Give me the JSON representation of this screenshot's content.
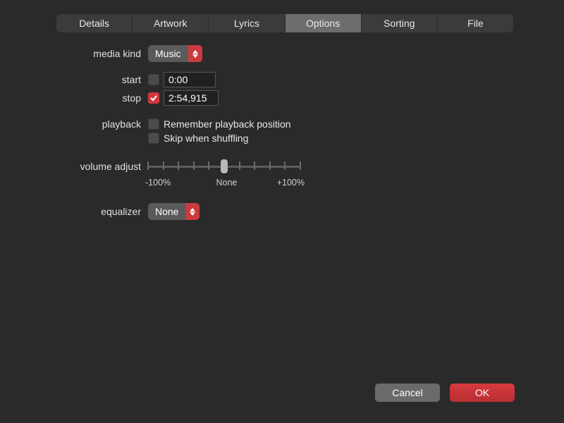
{
  "tabs": [
    {
      "label": "Details",
      "active": false
    },
    {
      "label": "Artwork",
      "active": false
    },
    {
      "label": "Lyrics",
      "active": false
    },
    {
      "label": "Options",
      "active": true
    },
    {
      "label": "Sorting",
      "active": false
    },
    {
      "label": "File",
      "active": false
    }
  ],
  "labels": {
    "media_kind": "media kind",
    "start": "start",
    "stop": "stop",
    "playback": "playback",
    "volume_adjust": "volume adjust",
    "equalizer": "equalizer"
  },
  "media_kind": {
    "value": "Music"
  },
  "start": {
    "checked": false,
    "value": "0:00"
  },
  "stop": {
    "checked": true,
    "value": "2:54,915"
  },
  "playback": {
    "remember": {
      "checked": false,
      "label": "Remember playback position"
    },
    "skip": {
      "checked": false,
      "label": "Skip when shuffling"
    }
  },
  "volume_adjust": {
    "ticks": 11,
    "position": 0.5,
    "captions": {
      "left": "-100%",
      "center": "None",
      "right": "+100%"
    }
  },
  "equalizer": {
    "value": "None"
  },
  "buttons": {
    "cancel": "Cancel",
    "ok": "OK"
  },
  "colors": {
    "accent": "#d0383c"
  }
}
